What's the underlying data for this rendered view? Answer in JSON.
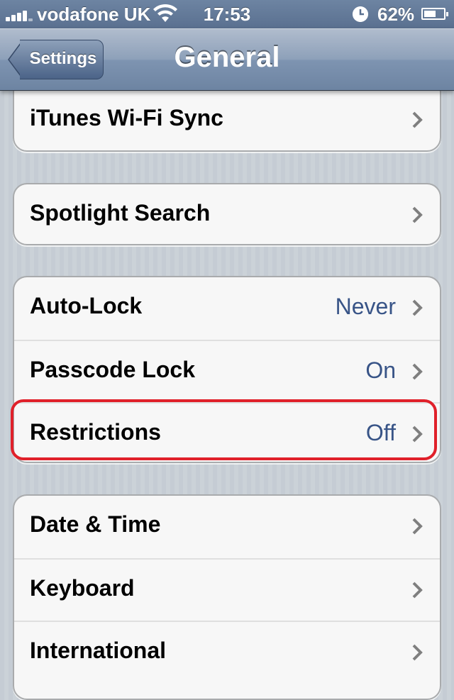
{
  "status_bar": {
    "carrier": "vodafone UK",
    "time": "17:53",
    "battery_percent": "62%",
    "battery_level": 0.62,
    "signal_bars": 4,
    "icons": [
      "signal-icon",
      "wifi-icon",
      "clock-icon",
      "battery-icon"
    ]
  },
  "nav": {
    "title": "General",
    "back_label": "Settings"
  },
  "groups": [
    {
      "rows": [
        {
          "label": "iTunes Wi-Fi Sync",
          "value": ""
        }
      ]
    },
    {
      "rows": [
        {
          "label": "Spotlight Search",
          "value": ""
        }
      ]
    },
    {
      "rows": [
        {
          "label": "Auto-Lock",
          "value": "Never"
        },
        {
          "label": "Passcode Lock",
          "value": "On"
        },
        {
          "label": "Restrictions",
          "value": "Off"
        }
      ]
    },
    {
      "rows": [
        {
          "label": "Date & Time",
          "value": ""
        },
        {
          "label": "Keyboard",
          "value": ""
        },
        {
          "label": "International",
          "value": ""
        }
      ]
    }
  ],
  "highlighted_row": "Restrictions",
  "colors": {
    "highlight": "#e0202a",
    "value_text": "#385487",
    "navbar": "#6d84a2"
  }
}
